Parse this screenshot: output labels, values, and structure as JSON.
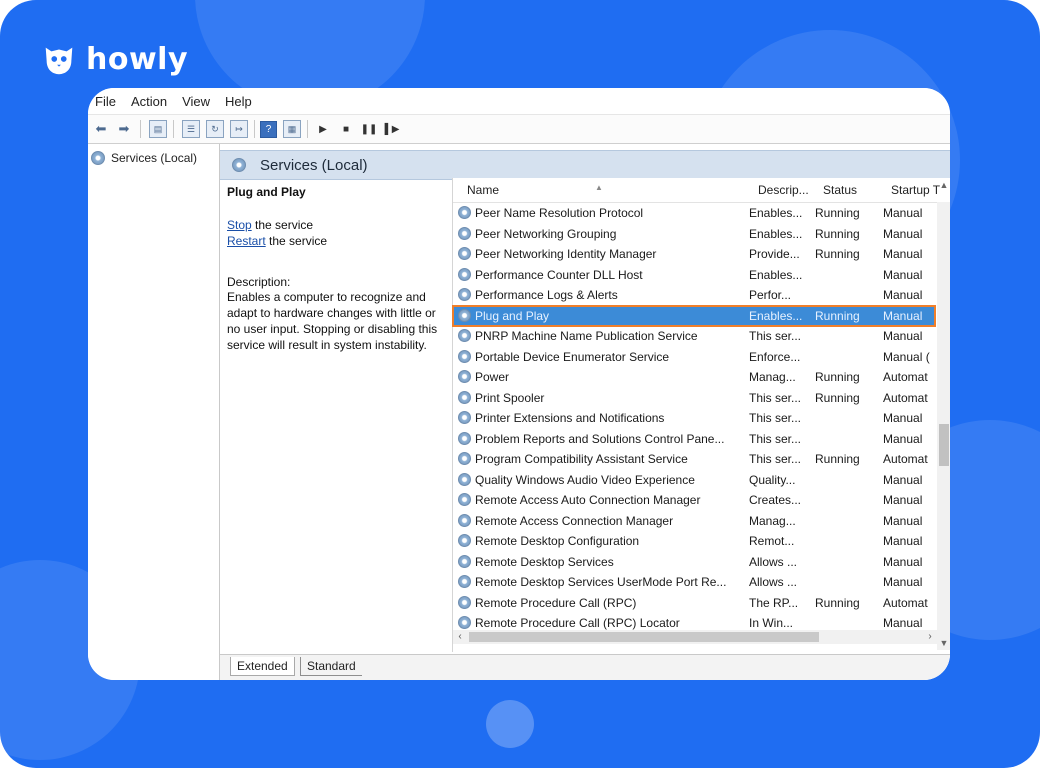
{
  "brand": {
    "name": "howly",
    "color": "#1f6df2"
  },
  "menu": [
    "File",
    "Action",
    "View",
    "Help"
  ],
  "toolbar": {
    "icons": [
      "back-arrow-icon",
      "forward-arrow-icon",
      "show-pane-icon",
      "properties-icon",
      "refresh-icon",
      "export-icon",
      "help-icon",
      "view-icon",
      "play-icon",
      "stop-icon",
      "pause-icon",
      "resume-icon"
    ]
  },
  "tree": {
    "root_label": "Services (Local)"
  },
  "header": {
    "title": "Services (Local)"
  },
  "details": {
    "service_name": "Plug and Play",
    "stop_link": "Stop",
    "stop_suffix": " the service",
    "restart_link": "Restart",
    "restart_suffix": " the service",
    "description_label": "Description:",
    "description": "Enables a computer to recognize and adapt to hardware changes with little or no user input. Stopping or disabling this service will result in system instability."
  },
  "columns": {
    "name": "Name",
    "description": "Descrip...",
    "status": "Status",
    "startup": "Startup T"
  },
  "selected_index": 5,
  "services": [
    {
      "name": "Peer Name Resolution Protocol",
      "description": "Enables...",
      "status": "Running",
      "startup": "Manual"
    },
    {
      "name": "Peer Networking Grouping",
      "description": "Enables...",
      "status": "Running",
      "startup": "Manual"
    },
    {
      "name": "Peer Networking Identity Manager",
      "description": "Provide...",
      "status": "Running",
      "startup": "Manual"
    },
    {
      "name": "Performance Counter DLL Host",
      "description": "Enables...",
      "status": "",
      "startup": "Manual"
    },
    {
      "name": "Performance Logs & Alerts",
      "description": "Perfor...",
      "status": "",
      "startup": "Manual"
    },
    {
      "name": "Plug and Play",
      "description": "Enables...",
      "status": "Running",
      "startup": "Manual"
    },
    {
      "name": "PNRP Machine Name Publication Service",
      "description": "This ser...",
      "status": "",
      "startup": "Manual"
    },
    {
      "name": "Portable Device Enumerator Service",
      "description": "Enforce...",
      "status": "",
      "startup": "Manual ("
    },
    {
      "name": "Power",
      "description": "Manag...",
      "status": "Running",
      "startup": "Automat"
    },
    {
      "name": "Print Spooler",
      "description": "This ser...",
      "status": "Running",
      "startup": "Automat"
    },
    {
      "name": "Printer Extensions and Notifications",
      "description": "This ser...",
      "status": "",
      "startup": "Manual"
    },
    {
      "name": "Problem Reports and Solutions Control Pane...",
      "description": "This ser...",
      "status": "",
      "startup": "Manual"
    },
    {
      "name": "Program Compatibility Assistant Service",
      "description": "This ser...",
      "status": "Running",
      "startup": "Automat"
    },
    {
      "name": "Quality Windows Audio Video Experience",
      "description": "Quality...",
      "status": "",
      "startup": "Manual"
    },
    {
      "name": "Remote Access Auto Connection Manager",
      "description": "Creates...",
      "status": "",
      "startup": "Manual"
    },
    {
      "name": "Remote Access Connection Manager",
      "description": "Manag...",
      "status": "",
      "startup": "Manual"
    },
    {
      "name": "Remote Desktop Configuration",
      "description": "Remot...",
      "status": "",
      "startup": "Manual"
    },
    {
      "name": "Remote Desktop Services",
      "description": "Allows ...",
      "status": "",
      "startup": "Manual"
    },
    {
      "name": "Remote Desktop Services UserMode Port Re...",
      "description": "Allows ...",
      "status": "",
      "startup": "Manual"
    },
    {
      "name": "Remote Procedure Call (RPC)",
      "description": "The RP...",
      "status": "Running",
      "startup": "Automat"
    },
    {
      "name": "Remote Procedure Call (RPC) Locator",
      "description": "In Win...",
      "status": "",
      "startup": "Manual"
    }
  ],
  "tabs": {
    "extended": "Extended",
    "standard": "Standard"
  },
  "selection_outline_color": "#f07f2a",
  "selection_color": "#3c8bd7"
}
